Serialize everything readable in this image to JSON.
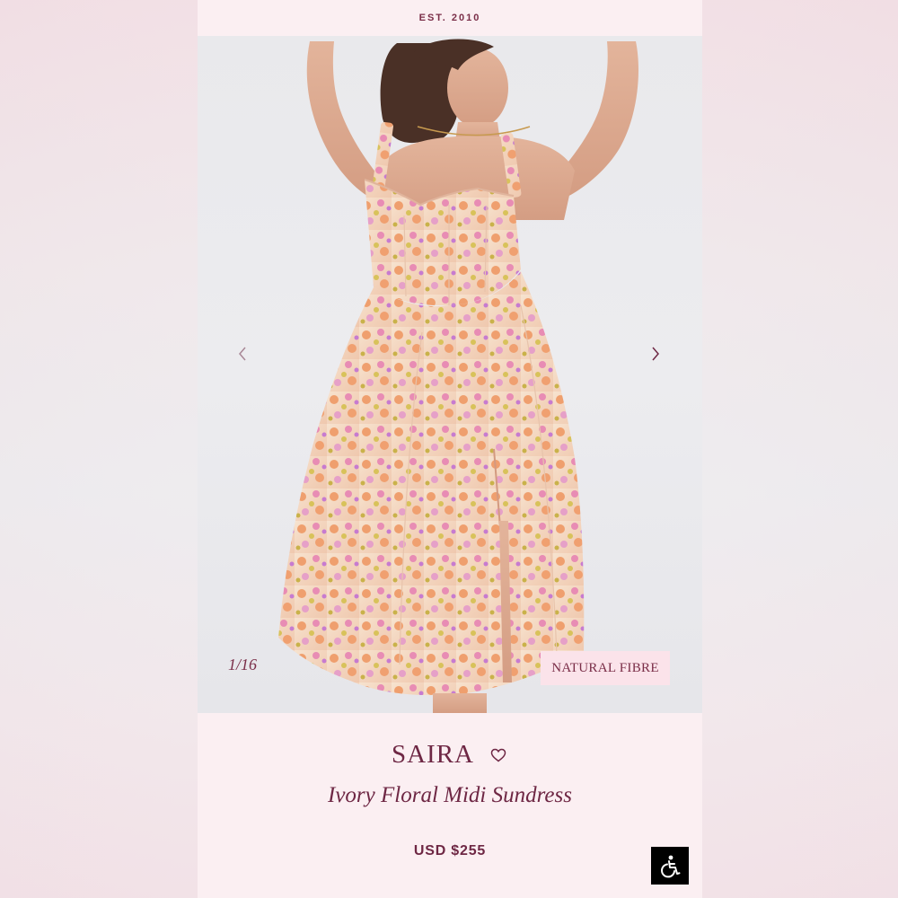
{
  "header": {
    "tagline": "EST. 2010"
  },
  "gallery": {
    "counter": "1/16",
    "badge": "NATURAL FIBRE",
    "prev_icon": "chevron-left-icon",
    "next_icon": "chevron-right-icon"
  },
  "product": {
    "name": "SAIRA",
    "subtitle": "Ivory Floral Midi Sundress",
    "price": "USD $255",
    "wishlist_icon": "heart-outline-icon"
  },
  "accessibility": {
    "icon": "wheelchair-icon"
  },
  "colors": {
    "brand": "#6e2744",
    "background": "#fbeff2",
    "badge_bg": "#fbe3ea"
  }
}
